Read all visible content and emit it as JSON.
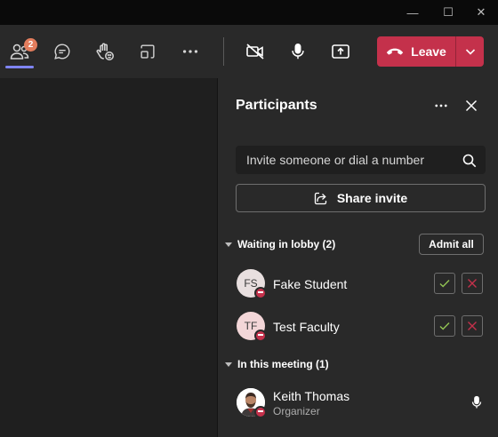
{
  "titlebar": {
    "minimize_glyph": "—",
    "maximize_glyph": "☐",
    "close_glyph": "✕"
  },
  "toolbar": {
    "participants_badge": "2",
    "leave_label": "Leave",
    "icons": [
      "people-icon",
      "chat-icon",
      "raise-hand-icon",
      "rooms-icon",
      "more-icon",
      "camera-off-icon",
      "mic-icon",
      "share-tray-icon",
      "phone-hangup-icon",
      "chevron-down-icon"
    ]
  },
  "panel": {
    "title": "Participants",
    "search_placeholder": "Invite someone or dial a number",
    "share_invite_label": "Share invite",
    "lobby": {
      "header": "Waiting in lobby (2)",
      "admit_all_label": "Admit all",
      "people": [
        {
          "initials": "FS",
          "name": "Fake Student",
          "avatar_color": "#e8dfdf"
        },
        {
          "initials": "TF",
          "name": "Test Faculty",
          "avatar_color": "#f3d6d8"
        }
      ]
    },
    "meeting": {
      "header": "In this meeting (1)",
      "people": [
        {
          "name": "Keith Thomas",
          "role": "Organizer"
        }
      ]
    }
  },
  "colors": {
    "leave_red": "#c4314b",
    "badge_orange": "#e37d5d",
    "accent_purple": "#7f85f5",
    "admit_green": "#92c353",
    "deny_red": "#c4314b"
  }
}
